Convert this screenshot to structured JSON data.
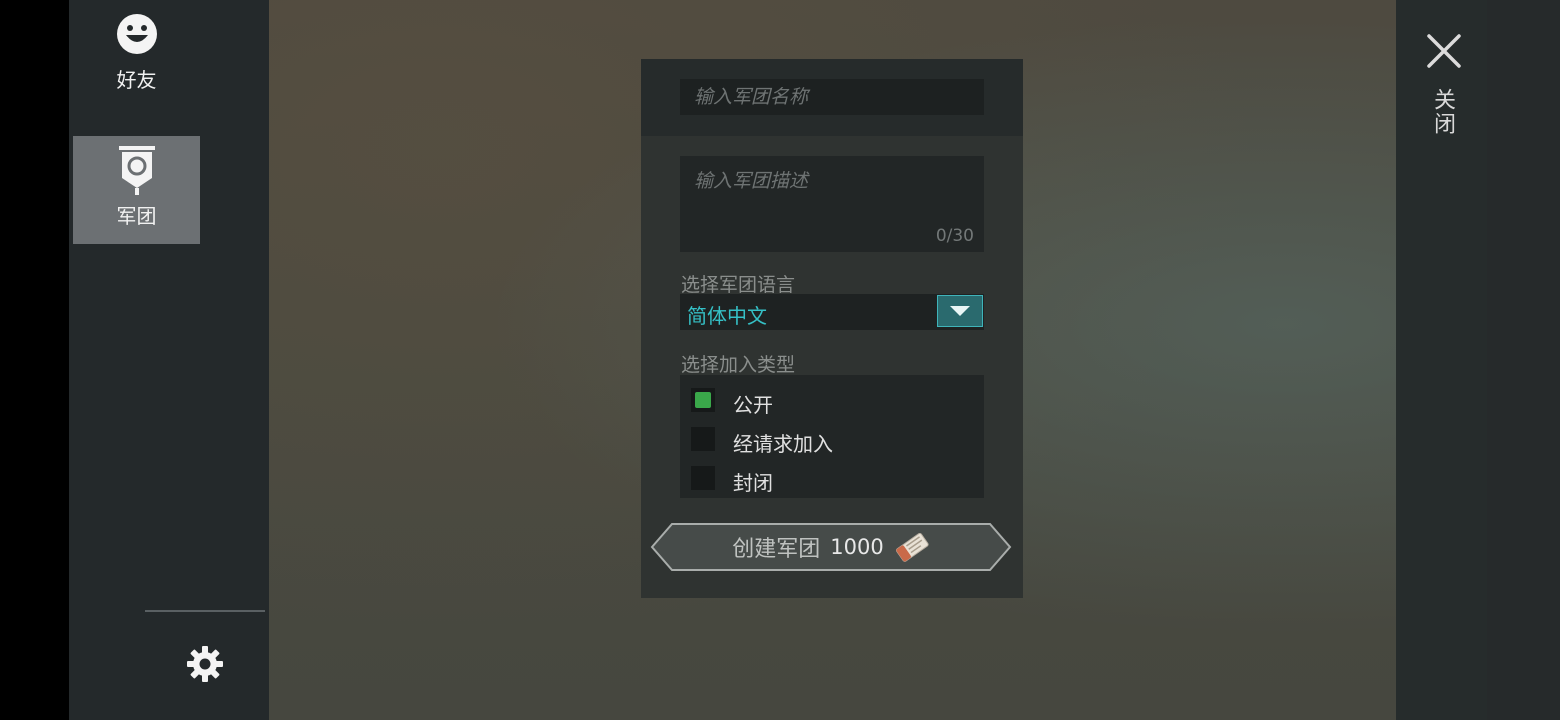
{
  "sidebar": {
    "items": [
      {
        "label": "好友",
        "icon": "smiley-icon",
        "active": false
      },
      {
        "label": "军团",
        "icon": "banner-icon",
        "active": true
      }
    ],
    "settings_icon": "gear-icon"
  },
  "close": {
    "label": "关闭",
    "icon": "close-icon"
  },
  "form": {
    "name_placeholder": "输入军团名称",
    "name_value": "",
    "desc_placeholder": "输入军团描述",
    "desc_value": "",
    "desc_count": "0/30",
    "language_label": "选择军团语言",
    "language_value": "简体中文",
    "join_type_label": "选择加入类型",
    "join_options": [
      {
        "label": "公开",
        "checked": true
      },
      {
        "label": "经请求加入",
        "checked": false
      },
      {
        "label": "封闭",
        "checked": false
      }
    ],
    "create_label": "创建军团",
    "create_cost": "1000",
    "cost_icon": "ticket-icon"
  },
  "colors": {
    "accent": "#35c0c6",
    "checked": "#3aa84a",
    "active_nav": "#6c7073"
  }
}
